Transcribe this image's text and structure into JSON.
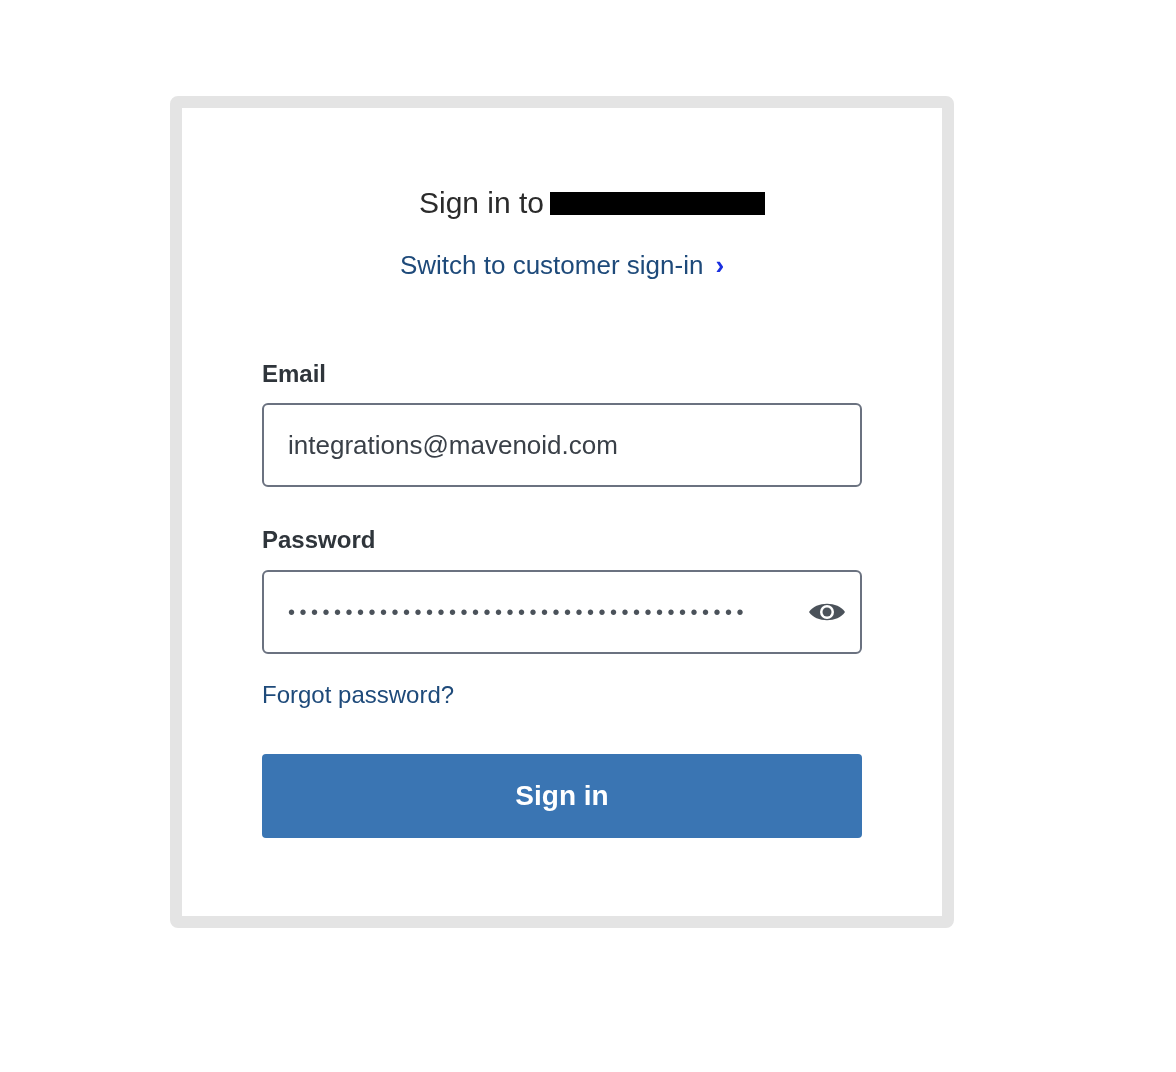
{
  "heading": {
    "text": "Sign in to"
  },
  "switch_link": {
    "text": "Switch to customer sign-in",
    "chevron": "›"
  },
  "email": {
    "label": "Email",
    "value": "integrations@mavenoid.com"
  },
  "password": {
    "label": "Password",
    "value": "••••••••••••••••••••••••••••••••••••••••",
    "show": false
  },
  "forgot_link": "Forgot password?",
  "submit": "Sign in"
}
